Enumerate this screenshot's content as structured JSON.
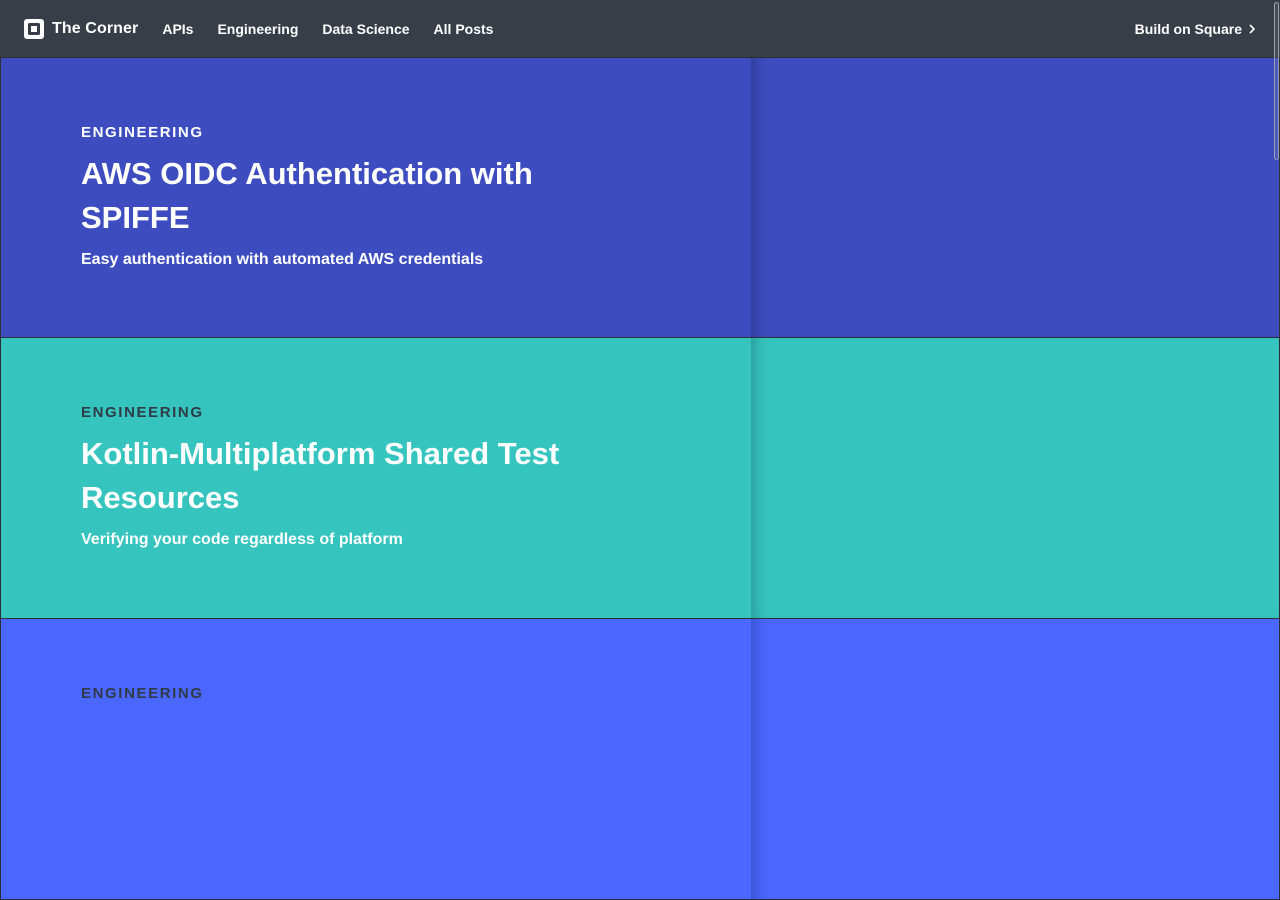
{
  "nav": {
    "brand": "The Corner",
    "links": [
      "APIs",
      "Engineering",
      "Data Science",
      "All Posts"
    ],
    "cta": "Build on Square",
    "icons": {
      "logo": "square-logo-icon",
      "cta": "chevron-right-icon"
    }
  },
  "posts": [
    {
      "category": "ENGINEERING",
      "title": "AWS OIDC Authentication with SPIFFE",
      "subtitle": "Easy authentication with automated AWS credentials",
      "bg": "#3d4dbf",
      "category_color": "#ffffff"
    },
    {
      "category": "ENGINEERING",
      "title": "Kotlin-Multiplatform Shared Test Resources",
      "subtitle": "Verifying your code regardless of platform",
      "bg": "#35c4be",
      "category_color": "#2f3b47"
    },
    {
      "category": "ENGINEERING",
      "title": "",
      "subtitle": "",
      "bg": "#4a67ff",
      "category_color": "#2f3b47"
    }
  ]
}
